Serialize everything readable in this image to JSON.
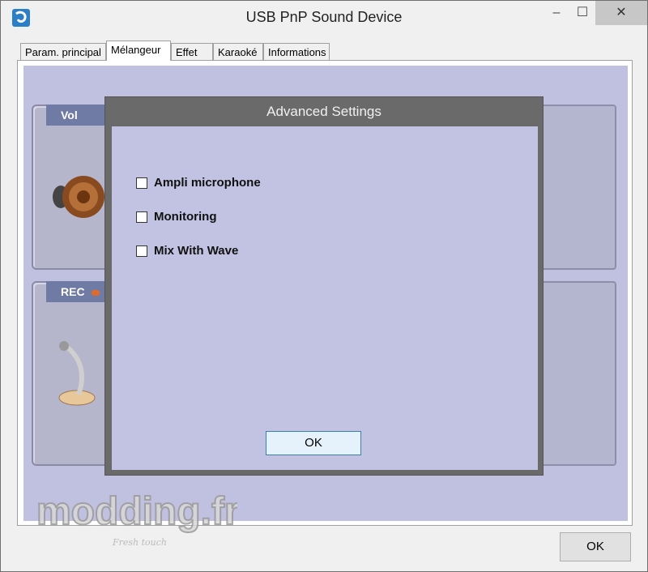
{
  "window": {
    "title": "USB PnP Sound Device",
    "app_icon": "sound-device-icon"
  },
  "titlebar_buttons": {
    "minimize": "–",
    "maximize": "☐",
    "close": "✕"
  },
  "tabs": [
    {
      "label": "Param. principal",
      "active": false
    },
    {
      "label": "Mélangeur",
      "active": true
    },
    {
      "label": "Effet",
      "active": false
    },
    {
      "label": "Karaoké",
      "active": false
    },
    {
      "label": "Informations",
      "active": false
    }
  ],
  "mixer": {
    "vol_label": "Vol",
    "rec_label": "REC"
  },
  "dialog": {
    "title": "Advanced Settings",
    "options": [
      {
        "label": "Ampli microphone",
        "checked": false
      },
      {
        "label": "Monitoring",
        "checked": false
      },
      {
        "label": "Mix With Wave",
        "checked": false
      }
    ],
    "ok_label": "OK"
  },
  "footer": {
    "ok_label": "OK"
  },
  "watermark": {
    "text": "modding.fr",
    "subtext": "Fresh touch"
  },
  "colors": {
    "panel_bg": "#c0c0e0",
    "dialog_frame": "#6a6a6a",
    "dialog_body": "#c2c3e2"
  }
}
